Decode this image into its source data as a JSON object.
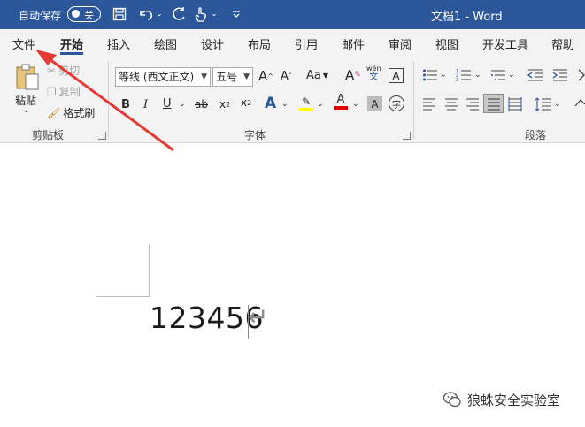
{
  "titlebar": {
    "autosave_label": "自动保存",
    "toggle_state": "关",
    "doc_title": "文档1 - Word"
  },
  "tabs": [
    {
      "label": "文件"
    },
    {
      "label": "开始"
    },
    {
      "label": "插入"
    },
    {
      "label": "绘图"
    },
    {
      "label": "设计"
    },
    {
      "label": "布局"
    },
    {
      "label": "引用"
    },
    {
      "label": "邮件"
    },
    {
      "label": "审阅"
    },
    {
      "label": "视图"
    },
    {
      "label": "开发工具"
    },
    {
      "label": "帮助"
    }
  ],
  "active_tab": "开始",
  "ribbon": {
    "clipboard": {
      "paste_label": "粘贴",
      "cut_label": "剪切",
      "copy_label": "复制",
      "format_painter_label": "格式刷",
      "group_label": "剪贴板"
    },
    "font": {
      "font_name": "等线 (西文正文)",
      "font_size": "五号",
      "group_label": "字体",
      "phonetic_top": "wén",
      "phonetic_bottom": "文"
    },
    "paragraph": {
      "group_label": "段落"
    }
  },
  "document": {
    "text": "123456"
  },
  "watermark": {
    "text": "狼蛛安全实验室"
  },
  "colors": {
    "titlebar_bg": "#2b579a",
    "highlight_yellow": "#ffff00",
    "font_color_red": "#e00000",
    "annotation_arrow": "#e53935"
  }
}
